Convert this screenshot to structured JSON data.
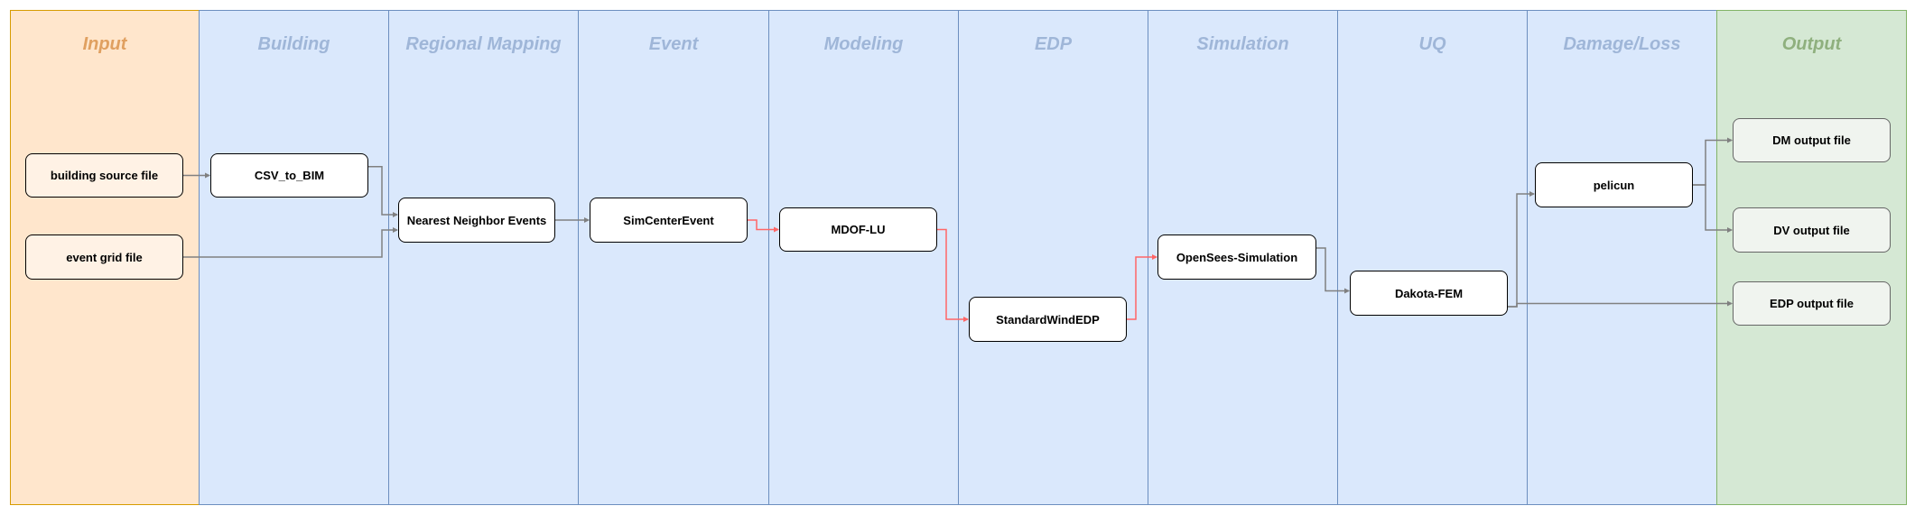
{
  "lanes": [
    {
      "id": "input",
      "title": "Input"
    },
    {
      "id": "building",
      "title": "Building"
    },
    {
      "id": "regional",
      "title": "Regional Mapping"
    },
    {
      "id": "event",
      "title": "Event"
    },
    {
      "id": "modeling",
      "title": "Modeling"
    },
    {
      "id": "edp",
      "title": "EDP"
    },
    {
      "id": "simulation",
      "title": "Simulation"
    },
    {
      "id": "uq",
      "title": "UQ"
    },
    {
      "id": "damage",
      "title": "Damage/Loss"
    },
    {
      "id": "output",
      "title": "Output"
    }
  ],
  "nodes": {
    "bsf": "building source file",
    "egf": "event grid file",
    "csv": "CSV_to_BIM",
    "nne": "Nearest Neighbor Events",
    "sce": "SimCenterEvent",
    "mdof": "MDOF-LU",
    "swe": "StandardWindEDP",
    "oss": "OpenSees-Simulation",
    "dak": "Dakota-FEM",
    "pel": "pelicun",
    "dm": "DM output file",
    "dv": "DV output file",
    "edpo": "EDP output file"
  },
  "edges": [
    {
      "from": "bsf",
      "to": "csv",
      "color": "#808080"
    },
    {
      "from": "csv",
      "to": "nne",
      "color": "#808080"
    },
    {
      "from": "egf",
      "to": "nne",
      "color": "#808080"
    },
    {
      "from": "nne",
      "to": "sce",
      "color": "#808080"
    },
    {
      "from": "sce",
      "to": "mdof",
      "color": "#ff6666"
    },
    {
      "from": "mdof",
      "to": "swe",
      "color": "#ff6666"
    },
    {
      "from": "swe",
      "to": "oss",
      "color": "#ff6666"
    },
    {
      "from": "oss",
      "to": "dak",
      "color": "#808080"
    },
    {
      "from": "dak",
      "to": "pel",
      "color": "#808080"
    },
    {
      "from": "dak",
      "to": "edpo",
      "color": "#808080"
    },
    {
      "from": "pel",
      "to": "dm",
      "color": "#808080"
    },
    {
      "from": "pel",
      "to": "dv",
      "color": "#808080"
    }
  ]
}
